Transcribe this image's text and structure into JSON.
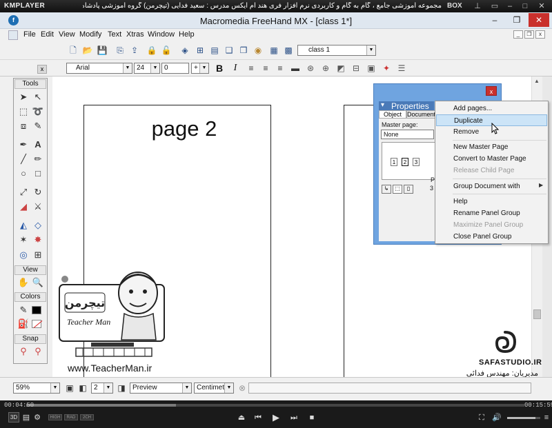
{
  "kmplayer": {
    "logo": "KMPLAYER",
    "title": "مجموعه آموزشی جامع ، گام به گام و کاربردی نرم افزار فری هند ام ایکس   مدرس : سعید فدایی (تیچرمن) گروه آموزشی پادشاه گرافیست ها",
    "box_label": "BOX",
    "time_current": "00:04:50",
    "time_total": "00:15:59",
    "progress": 0.3,
    "volume": 0.85,
    "badges": [
      "3D",
      "HIGH",
      "RAD",
      "2CH"
    ]
  },
  "app": {
    "title": "Macromedia FreeHand MX - [class 1*]",
    "icon_letter": "f",
    "menu": [
      "File",
      "Edit",
      "View",
      "Modify",
      "Text",
      "Xtras",
      "Window",
      "Help"
    ]
  },
  "toolbar": {
    "style_select": "class 1",
    "font_select": "Arial",
    "font_size": "24",
    "leading": "0",
    "leading_mode": "+"
  },
  "tools": {
    "header": "Tools",
    "view_header": "View",
    "colors_header": "Colors",
    "snap_header": "Snap"
  },
  "canvas": {
    "page_title": "page 2"
  },
  "properties": {
    "title": "Properties",
    "tab_object": "Object",
    "tab_document": "Document",
    "master_page_label": "Master page:",
    "master_page_value": "None",
    "thumb_labels": [
      "1",
      "2",
      "3"
    ],
    "p_label": "P",
    "value_3": "3"
  },
  "context_menu": {
    "items": [
      {
        "label": "Add pages...",
        "disabled": false,
        "highlight": false
      },
      {
        "label": "Duplicate",
        "disabled": false,
        "highlight": true
      },
      {
        "label": "Remove",
        "disabled": false,
        "highlight": false
      },
      {
        "label": "New Master Page",
        "disabled": false,
        "highlight": false
      },
      {
        "label": "Convert to Master Page",
        "disabled": false,
        "highlight": false
      },
      {
        "label": "Release Child Page",
        "disabled": true,
        "highlight": false
      },
      {
        "label": "Group Document with",
        "disabled": false,
        "highlight": false
      },
      {
        "label": "Help",
        "disabled": false,
        "highlight": false
      },
      {
        "label": "Rename Panel Group",
        "disabled": false,
        "highlight": false
      },
      {
        "label": "Maximize Panel Group",
        "disabled": true,
        "highlight": false
      },
      {
        "label": "Close Panel Group",
        "disabled": false,
        "highlight": false
      }
    ]
  },
  "statusbar": {
    "zoom": "59%",
    "page_number": "2",
    "view_mode": "Preview",
    "units": "Centimeters"
  },
  "watermark": {
    "site": "www.TeacherMan.ir",
    "brand": "Teacher Man",
    "studio": "SAFASTUDIO.IR",
    "designer": "مدیریان: مهندس فدائی"
  },
  "colors": {
    "accent_blue": "#6fa4e0",
    "highlight": "#cce4f7"
  }
}
